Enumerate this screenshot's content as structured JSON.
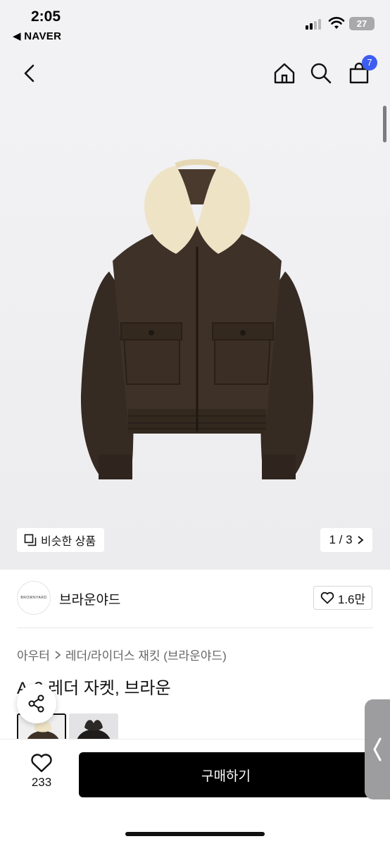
{
  "status_bar": {
    "time": "2:05",
    "back_app": "◀ NAVER",
    "battery": "27"
  },
  "nav": {
    "cart_count": "7"
  },
  "gallery": {
    "similar_label": "비슷한 상품",
    "counter": "1 / 3"
  },
  "store": {
    "logo_text": "BROWNYARD",
    "name": "브라운야드",
    "likes": "1.6만"
  },
  "breadcrumb": [
    "아우터",
    "레더/라이더스 재킷 (브라운야드)"
  ],
  "product": {
    "title": "A-2 레더 자켓, 브라운"
  },
  "bottom": {
    "wish_count": "233",
    "buy_label": "구매하기"
  },
  "colors": {
    "accent": "#3d5df0",
    "button": "#000000",
    "jacket": "#3d3128",
    "collar": "#efe3c6"
  },
  "icons": [
    "back-arrow-icon",
    "home-icon",
    "search-icon",
    "shopping-bag-icon",
    "copy-icon",
    "chevron-right-icon",
    "heart-icon",
    "share-icon"
  ]
}
